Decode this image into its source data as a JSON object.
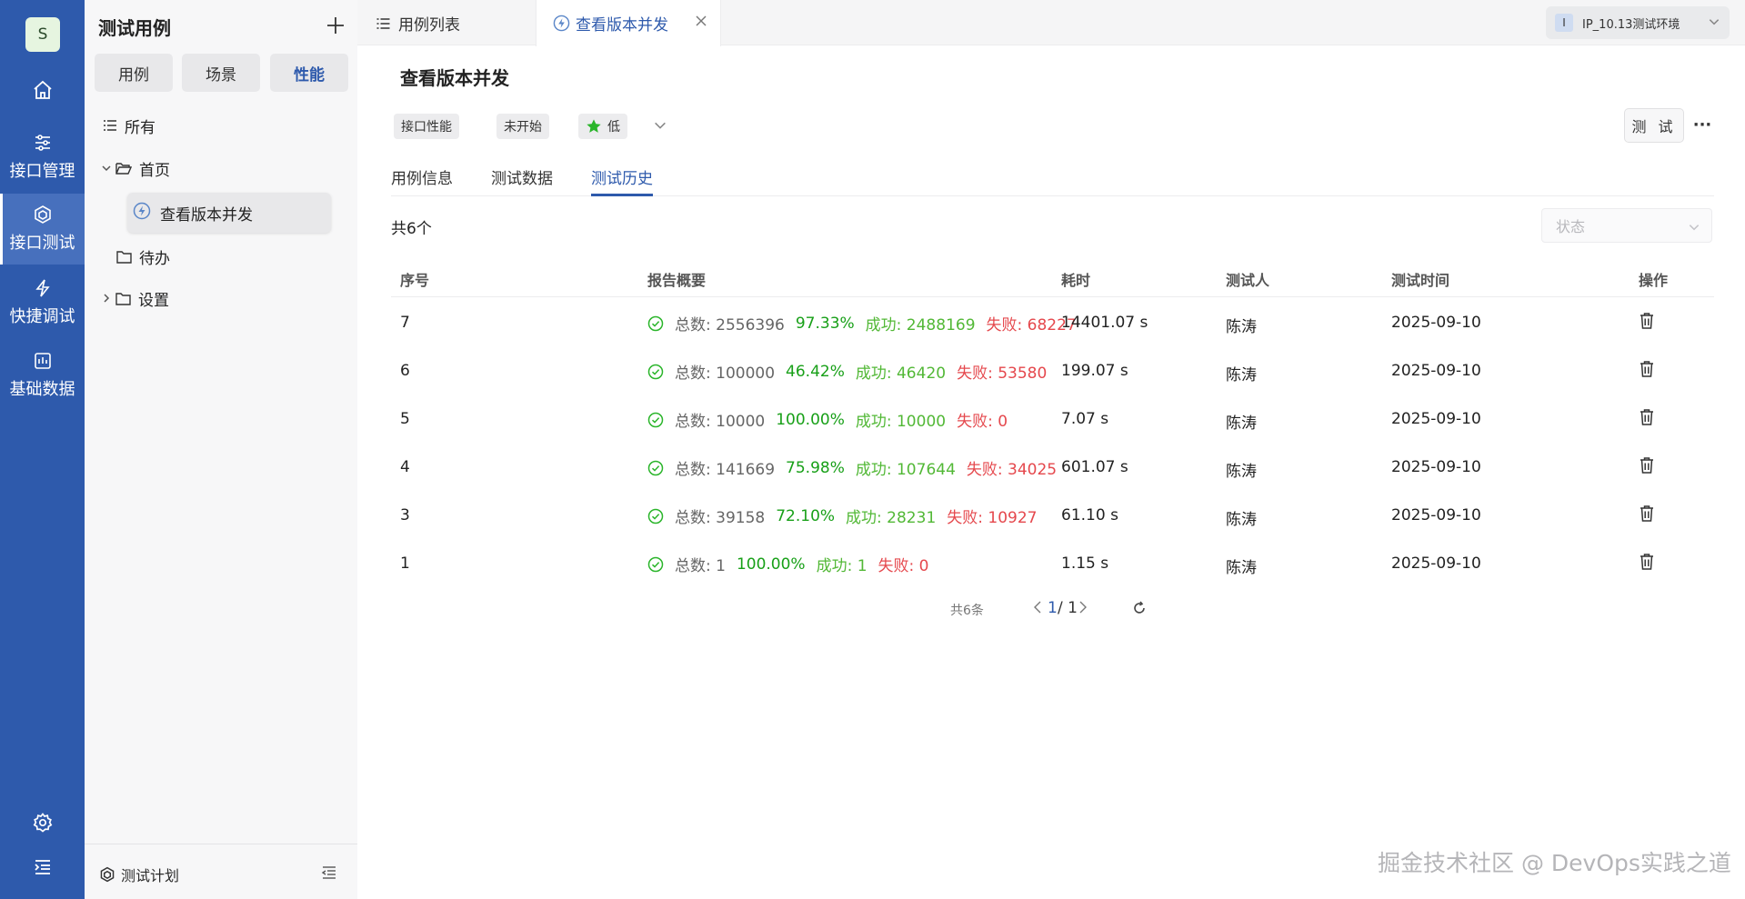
{
  "rail": {
    "avatar": "S",
    "items": [
      {
        "label": "接口管理"
      },
      {
        "label": "接口测试"
      },
      {
        "label": "快捷调试"
      },
      {
        "label": "基础数据"
      }
    ]
  },
  "panel": {
    "title": "测试用例",
    "segments": [
      "用例",
      "场景",
      "性能"
    ],
    "tree": {
      "all": "所有",
      "home": "首页",
      "case": "查看版本并发",
      "todo": "待办",
      "settings": "设置"
    },
    "footer": "测试计划"
  },
  "tabs": {
    "list": "用例列表",
    "current": "查看版本并发",
    "env_badge": "I",
    "env": "IP_10.13测试环境"
  },
  "detail": {
    "title": "查看版本并发",
    "tags": [
      "接口性能",
      "未开始",
      "低"
    ],
    "test_button": "测 试",
    "more": "···",
    "subtabs": [
      "用例信息",
      "测试数据",
      "测试历史"
    ],
    "count": "共6个",
    "status_placeholder": "状态"
  },
  "table": {
    "headers": [
      "序号",
      "报告概要",
      "耗时",
      "测试人",
      "测试时间",
      "操作"
    ],
    "rows": [
      {
        "id": "7",
        "total": "总数: 2556396",
        "rate": "97.33%",
        "ok": "成功: 2488169",
        "fail": "失败: 68227",
        "time": "14401.07 s",
        "user": "陈涛",
        "date": "2025-09-10"
      },
      {
        "id": "6",
        "total": "总数: 100000",
        "rate": "46.42%",
        "ok": "成功: 46420",
        "fail": "失败: 53580",
        "time": "199.07 s",
        "user": "陈涛",
        "date": "2025-09-10"
      },
      {
        "id": "5",
        "total": "总数: 10000",
        "rate": "100.00%",
        "ok": "成功: 10000",
        "fail": "失败: 0",
        "time": "7.07 s",
        "user": "陈涛",
        "date": "2025-09-10"
      },
      {
        "id": "4",
        "total": "总数: 141669",
        "rate": "75.98%",
        "ok": "成功: 107644",
        "fail": "失败: 34025",
        "time": "601.07 s",
        "user": "陈涛",
        "date": "2025-09-10"
      },
      {
        "id": "3",
        "total": "总数: 39158",
        "rate": "72.10%",
        "ok": "成功: 28231",
        "fail": "失败: 10927",
        "time": "61.10 s",
        "user": "陈涛",
        "date": "2025-09-10"
      },
      {
        "id": "1",
        "total": "总数: 1",
        "rate": "100.00%",
        "ok": "成功: 1",
        "fail": "失败: 0",
        "time": "1.15 s",
        "user": "陈涛",
        "date": "2025-09-10"
      }
    ]
  },
  "pager": {
    "total": "共6条",
    "current": "1",
    "sep": "/ 1"
  },
  "watermark": "掘金技术社区 @ DevOps实践之道",
  "colors": {
    "rail": "#2e5aac",
    "accent": "#2e5aac",
    "rate": "#18a018",
    "ok": "#52b836",
    "fail": "#e5484d"
  }
}
